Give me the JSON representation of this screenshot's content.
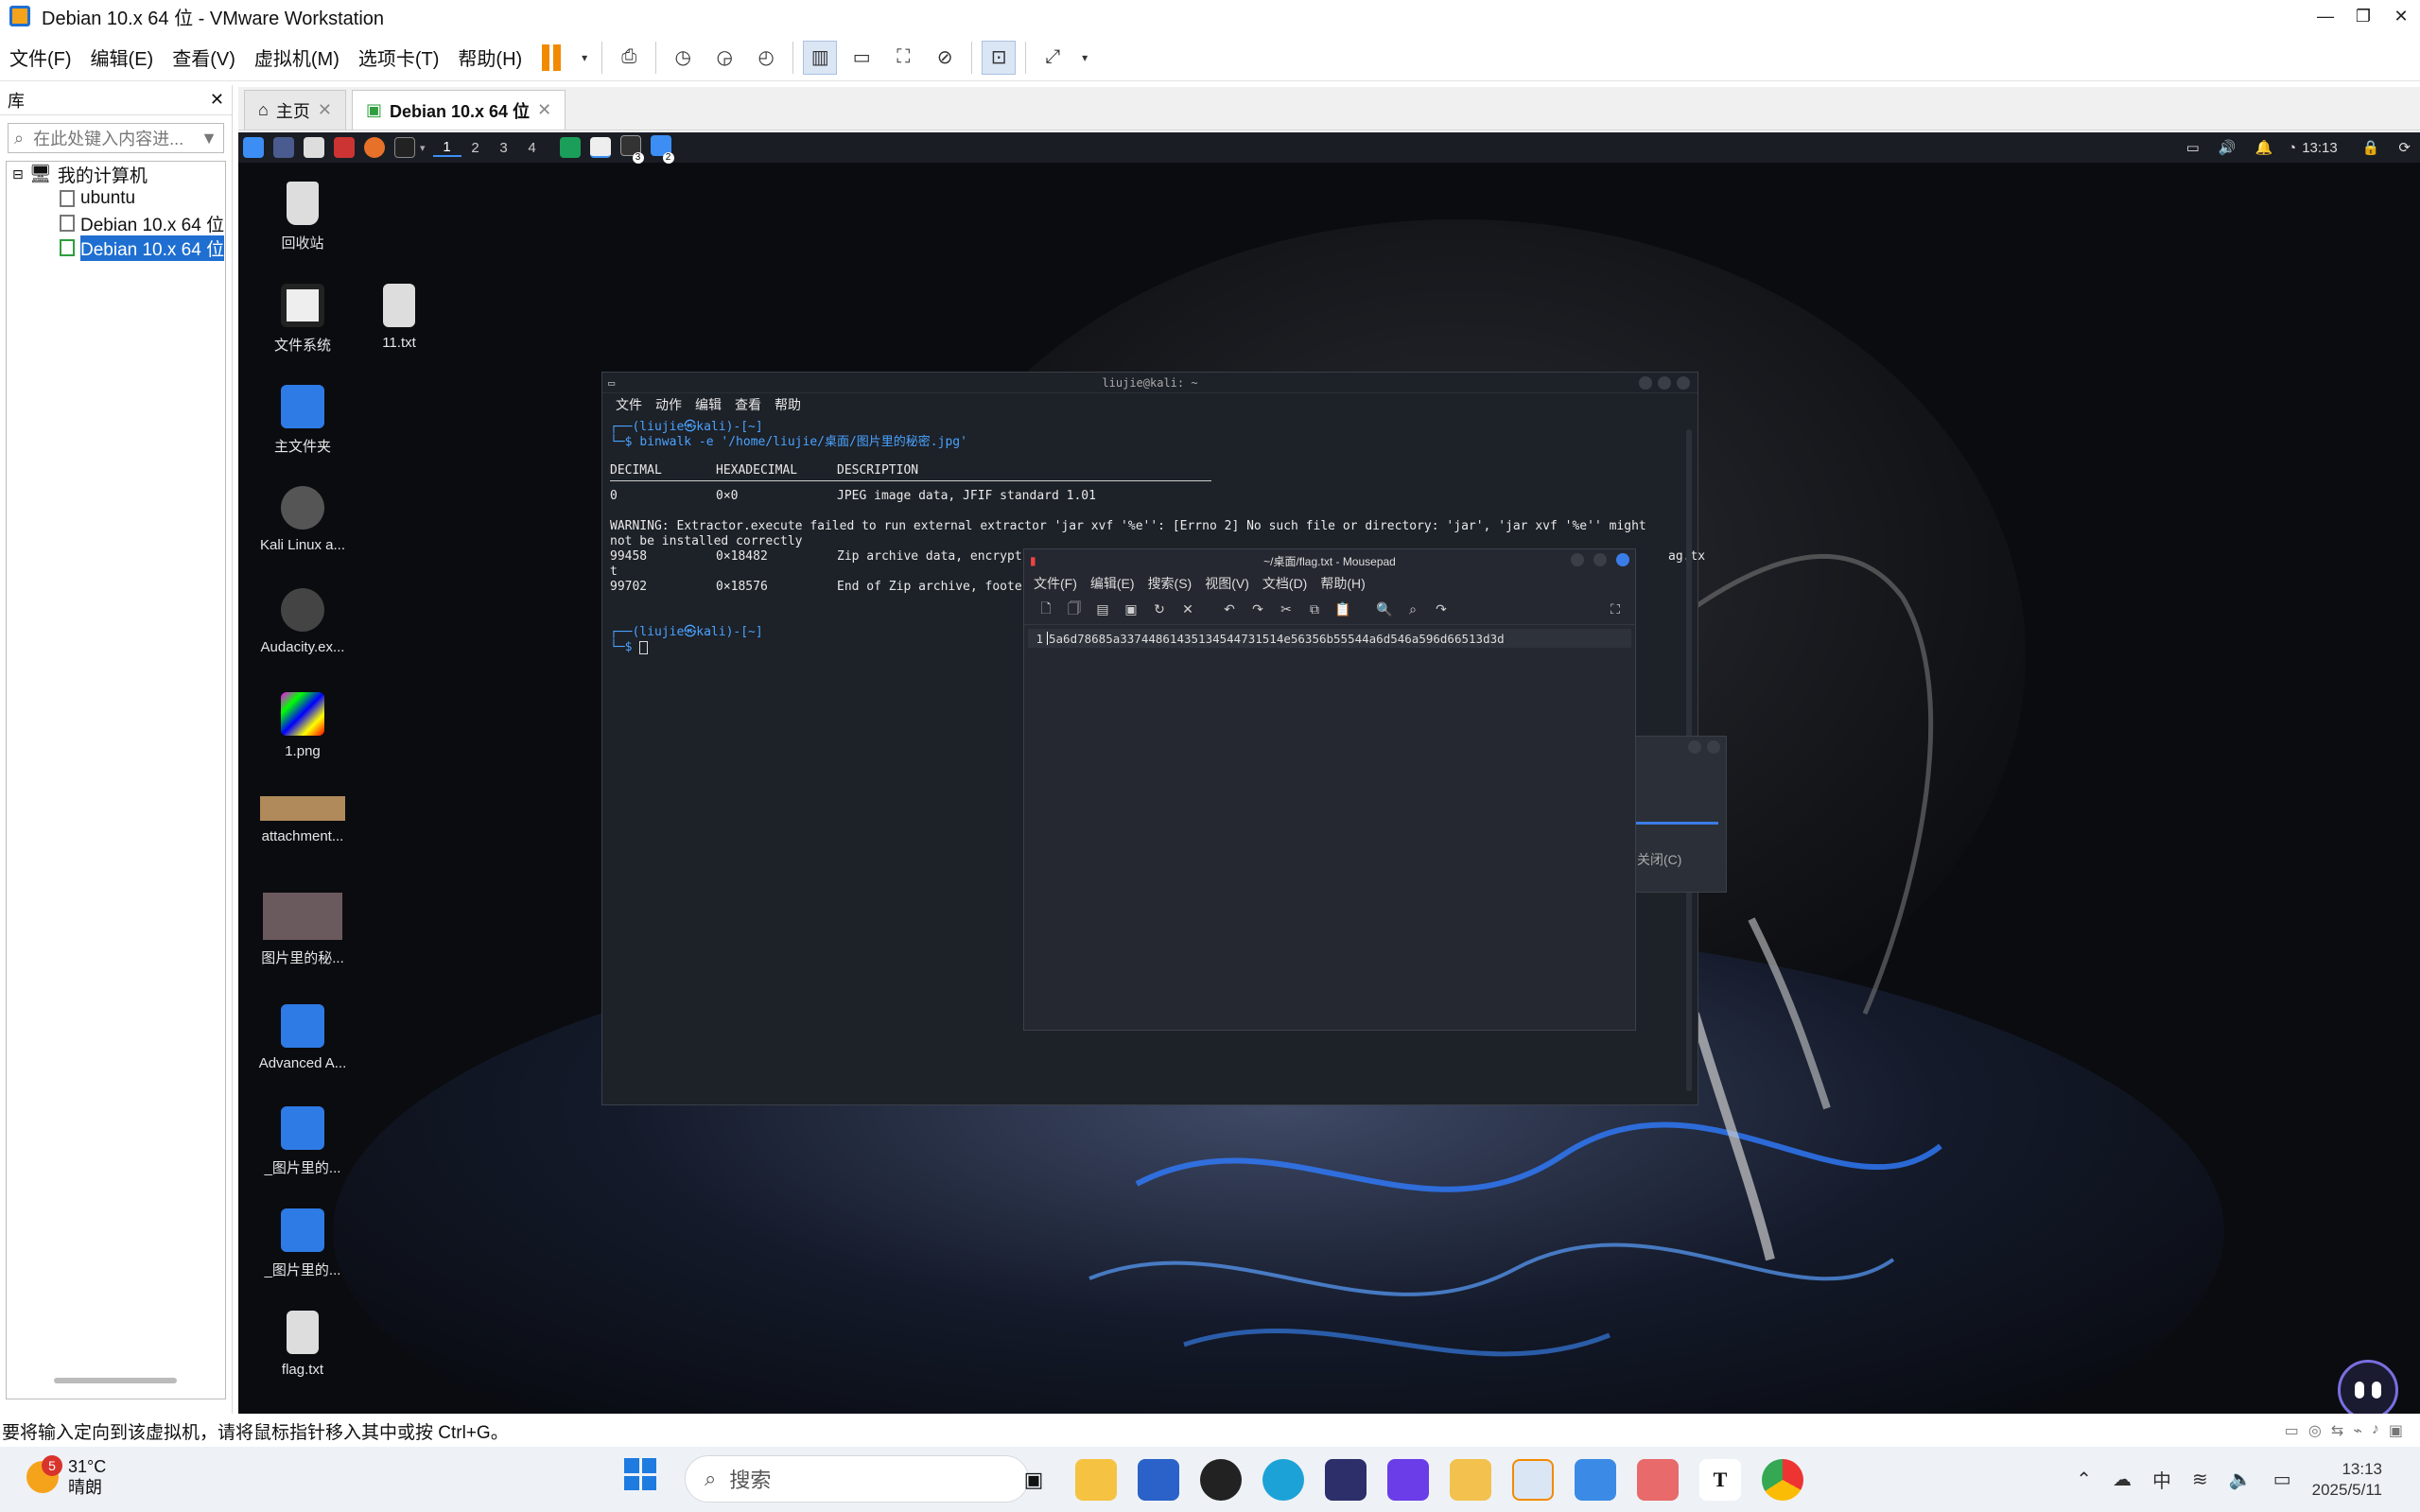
{
  "window": {
    "title": "Debian 10.x 64 位 - VMware Workstation"
  },
  "menu": [
    "文件(F)",
    "编辑(E)",
    "查看(V)",
    "虚拟机(M)",
    "选项卡(T)",
    "帮助(H)"
  ],
  "library": {
    "title": "库",
    "search_placeholder": "在此处键入内容进...",
    "root": "我的计算机",
    "vms": [
      "ubuntu",
      "Debian 10.x 64 位",
      "Debian 10.x 64 位"
    ]
  },
  "tabs": [
    {
      "label": "主页"
    },
    {
      "label": "Debian 10.x 64 位"
    }
  ],
  "kali_panel": {
    "workspaces": [
      "1",
      "2",
      "3",
      "4"
    ],
    "badges": [
      "3",
      "2"
    ],
    "time": "13:13"
  },
  "desktop_icons": [
    "回收站",
    "文件系统",
    "11.txt",
    "主文件夹",
    "Kali Linux a...",
    "Audacity.ex...",
    "1.png",
    "attachment...",
    "图片里的秘...",
    "Advanced A...",
    "_图片里的...",
    "_图片里的...",
    "flag.txt"
  ],
  "terminal": {
    "title": "liujie@kali: ~",
    "menu": [
      "文件",
      "动作",
      "编辑",
      "查看",
      "帮助"
    ],
    "prompt1": "┌──(liujie㉿kali)-[~]",
    "cmd_prefix": "└─$ ",
    "cmd": "binwalk -e '/home/liujie/桌面/图片里的秘密.jpg'",
    "headers": {
      "decimal": "DECIMAL",
      "hex": "HEXADECIMAL",
      "desc": "DESCRIPTION"
    },
    "rows": [
      {
        "decimal": "0",
        "hex": "0×0",
        "desc": "JPEG image data, JFIF standard 1.01"
      }
    ],
    "warning1": "WARNING: Extractor.execute failed to run external extractor 'jar xvf '%e'': [Errno 2] No such file or directory: 'jar', 'jar xvf '%e'' might",
    "warning2": "not be installed correctly",
    "row_zip": {
      "decimal": "99458",
      "hex": "0×18482",
      "desc": "Zip archive data, encrypt"
    },
    "row_zip_tail": "ag.tx",
    "row_t": "t",
    "row_end": {
      "decimal": "99702",
      "hex": "0×18576",
      "desc": "End of Zip archive, foote"
    },
    "prompt2": "┌──(liujie㉿kali)-[~]",
    "cmd2_prefix": "└─$ "
  },
  "mousepad": {
    "title": "~/桌面/flag.txt - Mousepad",
    "menu": [
      "文件(F)",
      "编辑(E)",
      "搜索(S)",
      "视图(V)",
      "文档(D)",
      "帮助(H)"
    ],
    "line_number": "1",
    "content": "5a6d78685a33744861435134544731514e56356b55544a6d546a596d66513d3d"
  },
  "dialog": {
    "close_label": "关闭(C)"
  },
  "statusbar": {
    "text": "要将输入定向到该虚拟机，请将鼠标指针移入其中或按 Ctrl+G。"
  },
  "taskbar": {
    "weather_temp": "31°C",
    "weather_desc": "晴朗",
    "weather_badge": "5",
    "search_placeholder": "搜索",
    "ime": "中",
    "time": "13:13",
    "date": "2025/5/11"
  },
  "colors": {
    "accent": "#1e6fd1",
    "pause": "#f28a00",
    "prompt": "#4aa3ff"
  }
}
